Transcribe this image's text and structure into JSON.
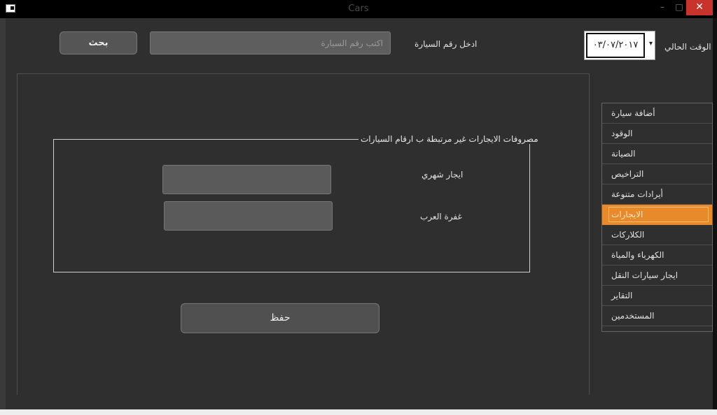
{
  "window": {
    "title": "Cars",
    "min_symbol": "–",
    "max_symbol": "□",
    "close_symbol": "✕"
  },
  "header": {
    "current_time_label": "الوقت الحالي",
    "date_value": "٠٣/٠٧/٢٠١٧",
    "dropdown_symbol": "▾",
    "car_number_label": "ادخل رقم السيارة",
    "search_placeholder": "اكتب رقم السيارة",
    "search_button": "بحث"
  },
  "group": {
    "title": "مصروفات الايجارات غير مرتبطة ب ارقام السيارات",
    "fields": [
      {
        "label": "ايجار شهري",
        "value": ""
      },
      {
        "label": "غفرة العرب",
        "value": ""
      }
    ],
    "save_button": "حفظ"
  },
  "menu": {
    "items": [
      {
        "label": "أضافة سيارة"
      },
      {
        "label": "الوقود"
      },
      {
        "label": "الصيانة"
      },
      {
        "label": "التراخيص"
      },
      {
        "label": "أيرادات متنوعة"
      },
      {
        "label": "الايجارات"
      },
      {
        "label": "الكلاركات"
      },
      {
        "label": "الكهرباء والمياة"
      },
      {
        "label": "ايجار سيارات النقل"
      },
      {
        "label": "التقاير"
      },
      {
        "label": "المستخدمين"
      }
    ],
    "active_index": 5
  },
  "colors": {
    "accent": "#e88a2a",
    "background": "#2f2f2f",
    "close_button": "#c8332b"
  }
}
